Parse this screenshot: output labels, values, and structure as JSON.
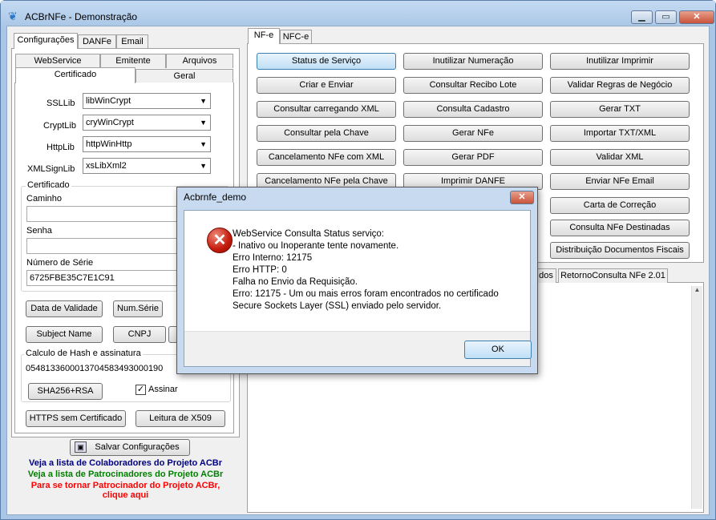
{
  "window": {
    "title": "ACBrNFe - Demonstração"
  },
  "left": {
    "tabs": [
      "Configurações",
      "DANFe",
      "Email"
    ],
    "subtabs_row1": [
      "WebService",
      "Emitente",
      "Arquivos"
    ],
    "subtabs_row2": [
      "Certificado",
      "Geral"
    ],
    "fields": [
      {
        "label": "SSLLib",
        "value": "libWinCrypt"
      },
      {
        "label": "CryptLib",
        "value": "cryWinCrypt"
      },
      {
        "label": "HttpLib",
        "value": "httpWinHttp"
      },
      {
        "label": "XMLSignLib",
        "value": "xsLibXml2"
      }
    ],
    "cert": {
      "group": "Certificado",
      "caminho": "Caminho",
      "senha": "Senha",
      "serie_label": "Número de Série",
      "serie_value": "6725FBE35C7E1C91"
    },
    "buttons": {
      "validade": "Data de Validade",
      "numserie": "Num.Série",
      "subject": "Subject Name",
      "cnpj": "CNPJ"
    },
    "hash": {
      "group": "Calculo de Hash e assinatura",
      "value": "05481336000137045834930001​90",
      "sha": "SHA256+RSA",
      "assinar": "Assinar"
    },
    "https": "HTTPS sem Certificado",
    "x509": "Leitura de X509",
    "save": "Salvar Configurações",
    "links": [
      {
        "text": "Veja a lista de Colaboradores do Projeto ACBr",
        "color": "#000080"
      },
      {
        "text": "Veja a lista de Patrocinadores do Projeto ACBr",
        "color": "#008000"
      },
      {
        "text": "Para se tornar Patrocinador do Projeto ACBr,",
        "color": "#ff0000"
      },
      {
        "text": "clique aqui",
        "color": "#ff0000"
      }
    ]
  },
  "right": {
    "tabs": [
      "NF-e",
      "NFC-e"
    ],
    "col1": [
      "Status de Serviço",
      "Criar e Enviar",
      "Consultar carregando XML",
      "Consultar pela Chave",
      "Cancelamento NFe com XML",
      "Cancelamento NFe pela Chave"
    ],
    "col2": [
      "Inutilizar Numeração",
      "Consultar Recibo Lote",
      "Consulta Cadastro",
      "Gerar NFe",
      "Gerar PDF",
      "Imprimir DANFE"
    ],
    "col3": [
      "Inutilizar Imprimir",
      "Validar Regras de Negócio",
      "Gerar TXT",
      "Importar TXT/XML",
      "Validar XML",
      "Enviar NFe Email",
      "Carta de Correção",
      "Consulta NFe Destinadas",
      "Distribuição Documentos Fiscais"
    ],
    "bottom_tabs": [
      "dos",
      "RetornoConsulta NFe 2.01"
    ]
  },
  "dialog": {
    "title": "Acbrnfe_demo",
    "message": "WebService Consulta Status serviço:\n- Inativo ou Inoperante tente novamente.\nErro Interno: 12175\nErro HTTP: 0\nFalha no Envio da Requisição.\nErro: 12175 - Um ou mais erros foram encontrados no certificado\nSecure Sockets Layer (SSL) enviado pelo servidor.",
    "ok": "OK"
  }
}
